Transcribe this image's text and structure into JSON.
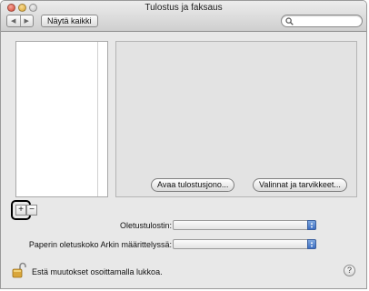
{
  "window": {
    "title": "Tulostus ja faksaus"
  },
  "toolbar": {
    "back_glyph": "◀",
    "forward_glyph": "▶",
    "show_all_label": "Näytä kaikki",
    "search_value": ""
  },
  "printers": {
    "items": []
  },
  "detail": {
    "open_queue_label": "Avaa tulostusjono...",
    "options_label": "Valinnat ja tarvikkeet..."
  },
  "list_controls": {
    "add_label": "+",
    "remove_label": "−"
  },
  "form": {
    "default_printer_label": "Oletustulostin:",
    "default_printer_value": "",
    "paper_size_label": "Paperin oletuskoko Arkin määrittelyssä:",
    "paper_size_value": ""
  },
  "footer": {
    "lock_text": "Estä muutokset osoittamalla lukkoa.",
    "help_label": "?"
  },
  "colors": {
    "window_background": "#e8e8e8",
    "popup_arrow_accent": "#3d6fc2",
    "lock_gold": "#d9a63a"
  }
}
